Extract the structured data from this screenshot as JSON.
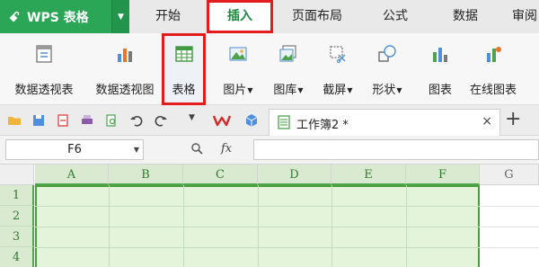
{
  "app": {
    "name": "WPS 表格"
  },
  "menu": {
    "tabs": [
      {
        "label": "开始"
      },
      {
        "label": "插入",
        "active": true
      },
      {
        "label": "页面布局"
      },
      {
        "label": "公式"
      },
      {
        "label": "数据"
      },
      {
        "label": "审阅"
      }
    ]
  },
  "ribbon": {
    "buttons": [
      {
        "label": "数据透视表",
        "icon": "pivot-table-icon"
      },
      {
        "label": "数据透视图",
        "icon": "pivot-chart-icon"
      },
      {
        "label": "表格",
        "icon": "table-icon",
        "highlighted": true
      },
      {
        "label": "图片",
        "icon": "picture-icon",
        "dropdown": true
      },
      {
        "label": "图库",
        "icon": "gallery-icon",
        "dropdown": true
      },
      {
        "label": "截屏",
        "icon": "screenshot-icon",
        "dropdown": true
      },
      {
        "label": "形状",
        "icon": "shapes-icon",
        "dropdown": true
      },
      {
        "label": "图表",
        "icon": "chart-icon"
      },
      {
        "label": "在线图表",
        "icon": "online-chart-icon"
      }
    ]
  },
  "quickbar": {
    "document_tab": "工作簿2 *",
    "close_glyph": "×",
    "new_tab_glyph": "+"
  },
  "formula_bar": {
    "name_box": "F6",
    "fx_label": "fx",
    "value": ""
  },
  "grid": {
    "columns": [
      "A",
      "B",
      "C",
      "D",
      "E",
      "F",
      "G"
    ],
    "rows": [
      "1",
      "2",
      "3",
      "4"
    ],
    "selected_range": "A1:F4"
  },
  "colors": {
    "brand_green": "#1f9e4a",
    "highlight_red": "#e31d1d",
    "selection_fill": "#e4f4db",
    "selection_border": "#4c9e3c"
  }
}
